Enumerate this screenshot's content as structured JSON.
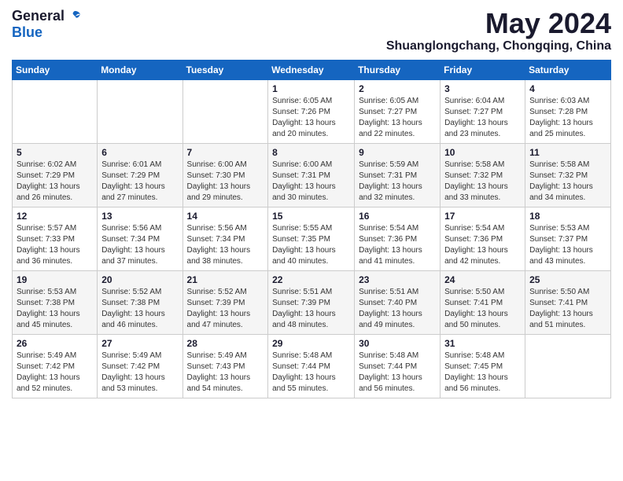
{
  "header": {
    "logo_general": "General",
    "logo_blue": "Blue",
    "month_title": "May 2024",
    "location": "Shuanglongchang, Chongqing, China"
  },
  "weekdays": [
    "Sunday",
    "Monday",
    "Tuesday",
    "Wednesday",
    "Thursday",
    "Friday",
    "Saturday"
  ],
  "weeks": [
    [
      {
        "day": "",
        "info": ""
      },
      {
        "day": "",
        "info": ""
      },
      {
        "day": "",
        "info": ""
      },
      {
        "day": "1",
        "info": "Sunrise: 6:05 AM\nSunset: 7:26 PM\nDaylight: 13 hours\nand 20 minutes."
      },
      {
        "day": "2",
        "info": "Sunrise: 6:05 AM\nSunset: 7:27 PM\nDaylight: 13 hours\nand 22 minutes."
      },
      {
        "day": "3",
        "info": "Sunrise: 6:04 AM\nSunset: 7:27 PM\nDaylight: 13 hours\nand 23 minutes."
      },
      {
        "day": "4",
        "info": "Sunrise: 6:03 AM\nSunset: 7:28 PM\nDaylight: 13 hours\nand 25 minutes."
      }
    ],
    [
      {
        "day": "5",
        "info": "Sunrise: 6:02 AM\nSunset: 7:29 PM\nDaylight: 13 hours\nand 26 minutes."
      },
      {
        "day": "6",
        "info": "Sunrise: 6:01 AM\nSunset: 7:29 PM\nDaylight: 13 hours\nand 27 minutes."
      },
      {
        "day": "7",
        "info": "Sunrise: 6:00 AM\nSunset: 7:30 PM\nDaylight: 13 hours\nand 29 minutes."
      },
      {
        "day": "8",
        "info": "Sunrise: 6:00 AM\nSunset: 7:31 PM\nDaylight: 13 hours\nand 30 minutes."
      },
      {
        "day": "9",
        "info": "Sunrise: 5:59 AM\nSunset: 7:31 PM\nDaylight: 13 hours\nand 32 minutes."
      },
      {
        "day": "10",
        "info": "Sunrise: 5:58 AM\nSunset: 7:32 PM\nDaylight: 13 hours\nand 33 minutes."
      },
      {
        "day": "11",
        "info": "Sunrise: 5:58 AM\nSunset: 7:32 PM\nDaylight: 13 hours\nand 34 minutes."
      }
    ],
    [
      {
        "day": "12",
        "info": "Sunrise: 5:57 AM\nSunset: 7:33 PM\nDaylight: 13 hours\nand 36 minutes."
      },
      {
        "day": "13",
        "info": "Sunrise: 5:56 AM\nSunset: 7:34 PM\nDaylight: 13 hours\nand 37 minutes."
      },
      {
        "day": "14",
        "info": "Sunrise: 5:56 AM\nSunset: 7:34 PM\nDaylight: 13 hours\nand 38 minutes."
      },
      {
        "day": "15",
        "info": "Sunrise: 5:55 AM\nSunset: 7:35 PM\nDaylight: 13 hours\nand 40 minutes."
      },
      {
        "day": "16",
        "info": "Sunrise: 5:54 AM\nSunset: 7:36 PM\nDaylight: 13 hours\nand 41 minutes."
      },
      {
        "day": "17",
        "info": "Sunrise: 5:54 AM\nSunset: 7:36 PM\nDaylight: 13 hours\nand 42 minutes."
      },
      {
        "day": "18",
        "info": "Sunrise: 5:53 AM\nSunset: 7:37 PM\nDaylight: 13 hours\nand 43 minutes."
      }
    ],
    [
      {
        "day": "19",
        "info": "Sunrise: 5:53 AM\nSunset: 7:38 PM\nDaylight: 13 hours\nand 45 minutes."
      },
      {
        "day": "20",
        "info": "Sunrise: 5:52 AM\nSunset: 7:38 PM\nDaylight: 13 hours\nand 46 minutes."
      },
      {
        "day": "21",
        "info": "Sunrise: 5:52 AM\nSunset: 7:39 PM\nDaylight: 13 hours\nand 47 minutes."
      },
      {
        "day": "22",
        "info": "Sunrise: 5:51 AM\nSunset: 7:39 PM\nDaylight: 13 hours\nand 48 minutes."
      },
      {
        "day": "23",
        "info": "Sunrise: 5:51 AM\nSunset: 7:40 PM\nDaylight: 13 hours\nand 49 minutes."
      },
      {
        "day": "24",
        "info": "Sunrise: 5:50 AM\nSunset: 7:41 PM\nDaylight: 13 hours\nand 50 minutes."
      },
      {
        "day": "25",
        "info": "Sunrise: 5:50 AM\nSunset: 7:41 PM\nDaylight: 13 hours\nand 51 minutes."
      }
    ],
    [
      {
        "day": "26",
        "info": "Sunrise: 5:49 AM\nSunset: 7:42 PM\nDaylight: 13 hours\nand 52 minutes."
      },
      {
        "day": "27",
        "info": "Sunrise: 5:49 AM\nSunset: 7:42 PM\nDaylight: 13 hours\nand 53 minutes."
      },
      {
        "day": "28",
        "info": "Sunrise: 5:49 AM\nSunset: 7:43 PM\nDaylight: 13 hours\nand 54 minutes."
      },
      {
        "day": "29",
        "info": "Sunrise: 5:48 AM\nSunset: 7:44 PM\nDaylight: 13 hours\nand 55 minutes."
      },
      {
        "day": "30",
        "info": "Sunrise: 5:48 AM\nSunset: 7:44 PM\nDaylight: 13 hours\nand 56 minutes."
      },
      {
        "day": "31",
        "info": "Sunrise: 5:48 AM\nSunset: 7:45 PM\nDaylight: 13 hours\nand 56 minutes."
      },
      {
        "day": "",
        "info": ""
      }
    ]
  ]
}
